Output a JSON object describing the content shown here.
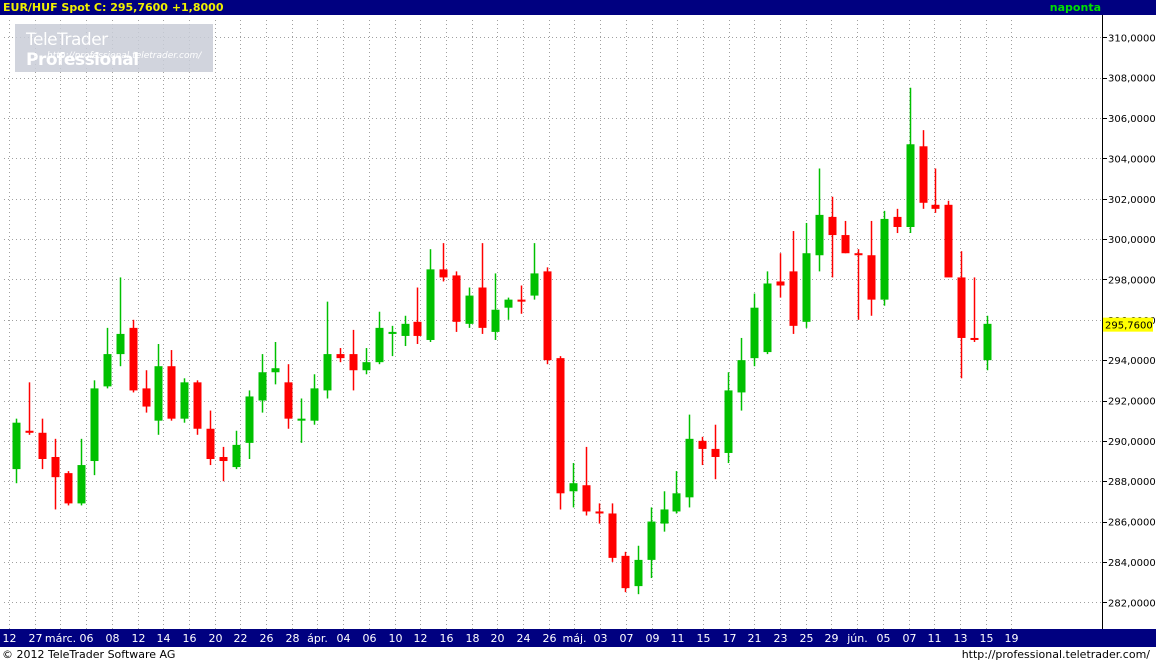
{
  "header": {
    "symbol": "EUR/HUF Spot",
    "close_label": "C:",
    "close_value": "295,7600",
    "change": "+1,8000",
    "interval": "naponta"
  },
  "logo": {
    "brand_light": "TeleTrader",
    "brand_bold": "Professional",
    "url": "http://professional.teletrader.com/"
  },
  "footer": {
    "copyright": "© 2012 TeleTrader Software AG",
    "url": "http://professional.teletrader.com/"
  },
  "colors": {
    "up": "#00c000",
    "down": "#ff0000",
    "axis_bg": "#000080",
    "header_text": "#f0f000",
    "grid": "#a0a0a0",
    "last_price_bg": "#ffff00"
  },
  "chart_data": {
    "type": "candlestick",
    "series_name": "EUR/HUF Spot",
    "ylim": [
      280.5,
      311.0
    ],
    "y_ticks": [
      "282,0000",
      "284,0000",
      "286,0000",
      "288,0000",
      "290,0000",
      "292,0000",
      "294,0000",
      "296,0000",
      "298,0000",
      "300,0000",
      "302,0000",
      "304,0000",
      "306,0000",
      "308,0000",
      "310,0000"
    ],
    "y_tick_values": [
      282,
      284,
      286,
      288,
      290,
      292,
      294,
      296,
      298,
      300,
      302,
      304,
      306,
      308,
      310
    ],
    "x_ticks": [
      "12",
      "27",
      "márc.",
      "06",
      "08",
      "12",
      "14",
      "16",
      "20",
      "22",
      "26",
      "28",
      "ápr.",
      "04",
      "06",
      "10",
      "12",
      "16",
      "18",
      "20",
      "24",
      "26",
      "máj.",
      "03",
      "07",
      "09",
      "11",
      "15",
      "17",
      "21",
      "23",
      "25",
      "29",
      "jún.",
      "05",
      "07",
      "11",
      "13",
      "15",
      "19"
    ],
    "last_price_label": "295,7600",
    "last_price": 295.76,
    "candles": [
      {
        "o": 288.6,
        "h": 291.1,
        "l": 287.9,
        "c": 290.9
      },
      {
        "o": 290.5,
        "h": 292.9,
        "l": 290.3,
        "c": 290.4
      },
      {
        "o": 290.4,
        "h": 291.1,
        "l": 288.6,
        "c": 289.1
      },
      {
        "o": 289.2,
        "h": 290.1,
        "l": 286.6,
        "c": 288.2
      },
      {
        "o": 288.4,
        "h": 288.5,
        "l": 286.8,
        "c": 286.9
      },
      {
        "o": 286.9,
        "h": 290.1,
        "l": 286.8,
        "c": 288.8
      },
      {
        "o": 289.0,
        "h": 293.0,
        "l": 288.3,
        "c": 292.6
      },
      {
        "o": 292.7,
        "h": 295.6,
        "l": 292.6,
        "c": 294.3
      },
      {
        "o": 294.3,
        "h": 298.1,
        "l": 293.7,
        "c": 295.3
      },
      {
        "o": 295.6,
        "h": 296.0,
        "l": 292.4,
        "c": 292.5
      },
      {
        "o": 292.6,
        "h": 293.5,
        "l": 291.4,
        "c": 291.7
      },
      {
        "o": 291.0,
        "h": 294.8,
        "l": 290.3,
        "c": 293.7
      },
      {
        "o": 293.7,
        "h": 294.5,
        "l": 291.0,
        "c": 291.1
      },
      {
        "o": 291.1,
        "h": 293.1,
        "l": 290.9,
        "c": 292.9
      },
      {
        "o": 292.9,
        "h": 293.0,
        "l": 290.3,
        "c": 290.6
      },
      {
        "o": 290.6,
        "h": 291.5,
        "l": 288.8,
        "c": 289.1
      },
      {
        "o": 289.2,
        "h": 289.7,
        "l": 288.0,
        "c": 289.0
      },
      {
        "o": 288.7,
        "h": 290.5,
        "l": 288.6,
        "c": 289.8
      },
      {
        "o": 289.9,
        "h": 292.5,
        "l": 289.1,
        "c": 292.2
      },
      {
        "o": 292.0,
        "h": 294.3,
        "l": 291.4,
        "c": 293.4
      },
      {
        "o": 293.4,
        "h": 294.9,
        "l": 292.8,
        "c": 293.6
      },
      {
        "o": 292.9,
        "h": 293.8,
        "l": 290.6,
        "c": 291.1
      },
      {
        "o": 291.0,
        "h": 292.1,
        "l": 289.9,
        "c": 291.1
      },
      {
        "o": 291.0,
        "h": 293.3,
        "l": 290.8,
        "c": 292.6
      },
      {
        "o": 292.5,
        "h": 296.9,
        "l": 292.1,
        "c": 294.3
      },
      {
        "o": 294.3,
        "h": 294.6,
        "l": 293.9,
        "c": 294.1
      },
      {
        "o": 294.3,
        "h": 295.5,
        "l": 292.5,
        "c": 293.5
      },
      {
        "o": 293.5,
        "h": 294.6,
        "l": 293.3,
        "c": 293.9
      },
      {
        "o": 293.9,
        "h": 296.4,
        "l": 293.8,
        "c": 295.6
      },
      {
        "o": 295.3,
        "h": 295.7,
        "l": 294.2,
        "c": 295.4
      },
      {
        "o": 295.2,
        "h": 296.2,
        "l": 294.7,
        "c": 295.8
      },
      {
        "o": 295.9,
        "h": 297.6,
        "l": 294.8,
        "c": 295.2
      },
      {
        "o": 295.0,
        "h": 299.5,
        "l": 294.9,
        "c": 298.5
      },
      {
        "o": 298.5,
        "h": 299.8,
        "l": 297.9,
        "c": 298.1
      },
      {
        "o": 298.2,
        "h": 298.4,
        "l": 295.4,
        "c": 295.9
      },
      {
        "o": 295.8,
        "h": 297.6,
        "l": 295.6,
        "c": 297.2
      },
      {
        "o": 297.6,
        "h": 299.8,
        "l": 295.3,
        "c": 295.6
      },
      {
        "o": 295.4,
        "h": 298.3,
        "l": 295.0,
        "c": 296.5
      },
      {
        "o": 296.6,
        "h": 297.1,
        "l": 296.0,
        "c": 297.0
      },
      {
        "o": 297.0,
        "h": 297.7,
        "l": 296.3,
        "c": 296.9
      },
      {
        "o": 297.2,
        "h": 299.8,
        "l": 297.0,
        "c": 298.3
      },
      {
        "o": 298.4,
        "h": 298.6,
        "l": 293.8,
        "c": 294.0
      },
      {
        "o": 294.1,
        "h": 294.2,
        "l": 286.6,
        "c": 287.4
      },
      {
        "o": 287.5,
        "h": 288.9,
        "l": 286.7,
        "c": 287.9
      },
      {
        "o": 287.8,
        "h": 289.7,
        "l": 286.3,
        "c": 286.5
      },
      {
        "o": 286.5,
        "h": 286.9,
        "l": 285.9,
        "c": 286.4
      },
      {
        "o": 286.4,
        "h": 286.9,
        "l": 284.0,
        "c": 284.2
      },
      {
        "o": 284.3,
        "h": 284.5,
        "l": 282.5,
        "c": 282.7
      },
      {
        "o": 282.8,
        "h": 284.8,
        "l": 282.4,
        "c": 284.1
      },
      {
        "o": 284.1,
        "h": 286.7,
        "l": 283.2,
        "c": 286.0
      },
      {
        "o": 285.9,
        "h": 287.5,
        "l": 285.5,
        "c": 286.6
      },
      {
        "o": 286.5,
        "h": 288.5,
        "l": 286.4,
        "c": 287.4
      },
      {
        "o": 287.2,
        "h": 291.3,
        "l": 286.7,
        "c": 290.1
      },
      {
        "o": 290.0,
        "h": 290.2,
        "l": 288.8,
        "c": 289.6
      },
      {
        "o": 289.6,
        "h": 290.8,
        "l": 288.1,
        "c": 289.2
      },
      {
        "o": 289.4,
        "h": 293.4,
        "l": 288.9,
        "c": 292.5
      },
      {
        "o": 292.4,
        "h": 295.1,
        "l": 291.5,
        "c": 294.0
      },
      {
        "o": 294.1,
        "h": 297.3,
        "l": 293.7,
        "c": 296.6
      },
      {
        "o": 294.4,
        "h": 298.4,
        "l": 294.3,
        "c": 297.8
      },
      {
        "o": 297.9,
        "h": 299.3,
        "l": 297.1,
        "c": 297.7
      },
      {
        "o": 298.4,
        "h": 300.4,
        "l": 295.3,
        "c": 295.7
      },
      {
        "o": 295.9,
        "h": 300.8,
        "l": 295.6,
        "c": 299.3
      },
      {
        "o": 299.2,
        "h": 303.5,
        "l": 298.4,
        "c": 301.2
      },
      {
        "o": 301.1,
        "h": 302.1,
        "l": 298.1,
        "c": 300.2
      },
      {
        "o": 300.2,
        "h": 300.9,
        "l": 299.3,
        "c": 299.3
      },
      {
        "o": 299.3,
        "h": 299.5,
        "l": 296.0,
        "c": 299.2
      },
      {
        "o": 299.2,
        "h": 300.9,
        "l": 296.2,
        "c": 297.0
      },
      {
        "o": 297.0,
        "h": 301.4,
        "l": 296.7,
        "c": 301.0
      },
      {
        "o": 301.1,
        "h": 301.5,
        "l": 300.3,
        "c": 300.6
      },
      {
        "o": 300.6,
        "h": 307.5,
        "l": 300.3,
        "c": 304.7
      },
      {
        "o": 304.6,
        "h": 305.4,
        "l": 301.5,
        "c": 301.8
      },
      {
        "o": 301.7,
        "h": 303.5,
        "l": 301.3,
        "c": 301.5
      },
      {
        "o": 301.7,
        "h": 301.9,
        "l": 298.5,
        "c": 298.1
      },
      {
        "o": 298.1,
        "h": 299.4,
        "l": 293.1,
        "c": 295.1
      },
      {
        "o": 295.1,
        "h": 298.1,
        "l": 294.9,
        "c": 295.0
      },
      {
        "o": 294.0,
        "h": 296.2,
        "l": 293.5,
        "c": 295.8
      }
    ]
  }
}
